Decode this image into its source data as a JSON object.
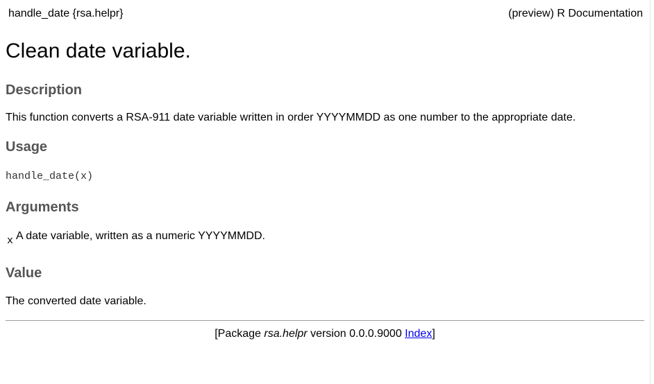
{
  "header": {
    "left": "handle_date {rsa.helpr}",
    "right": "(preview) R Documentation"
  },
  "title": "Clean date variable.",
  "sections": {
    "description": {
      "heading": "Description",
      "text": "This function converts a RSA-911 date variable written in order YYYYMMDD as one number to the appropriate date."
    },
    "usage": {
      "heading": "Usage",
      "code": "handle_date(x)"
    },
    "arguments": {
      "heading": "Arguments",
      "items": [
        {
          "name": "x",
          "desc": "A date variable, written as a numeric YYYYMMDD."
        }
      ]
    },
    "value": {
      "heading": "Value",
      "text": "The converted date variable."
    }
  },
  "footer": {
    "prefix": "[Package ",
    "package": "rsa.helpr",
    "version_text": " version 0.0.0.9000 ",
    "index_link": "Index",
    "suffix": "]"
  }
}
